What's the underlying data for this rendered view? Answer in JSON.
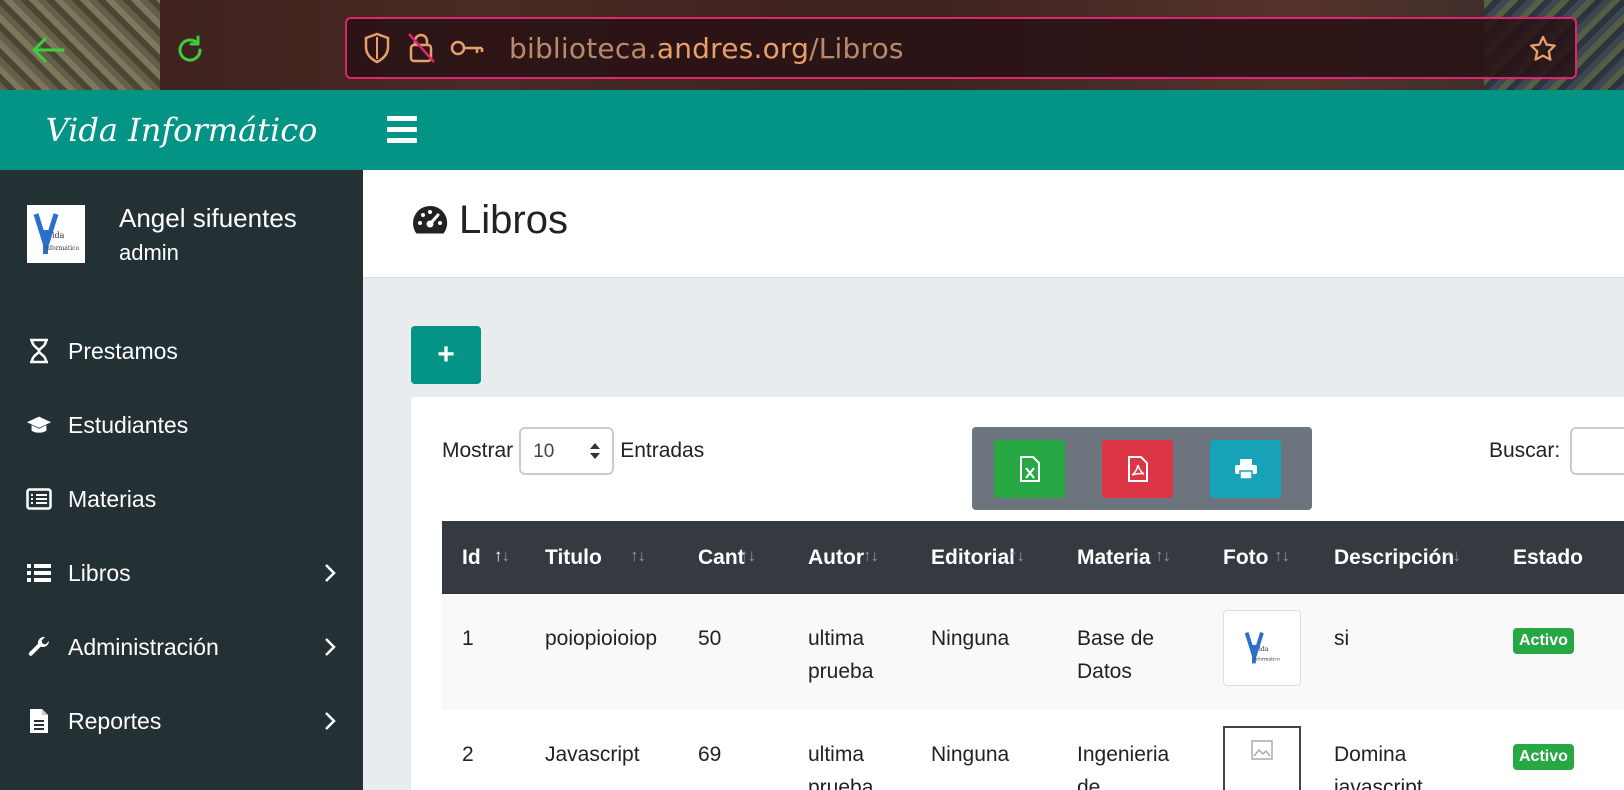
{
  "browser": {
    "url_prefix": "biblioteca.",
    "url_domain": "andres.org",
    "url_path": "/Libros"
  },
  "sidebar": {
    "brand": "Vida Informático",
    "avatar_text": "Vida Informático",
    "user_name": "Angel sifuentes",
    "user_role": "admin",
    "items": [
      {
        "label": "Prestamos",
        "icon": "hourglass-icon",
        "has_children": false
      },
      {
        "label": "Estudiantes",
        "icon": "graduation-cap-icon",
        "has_children": false
      },
      {
        "label": "Materias",
        "icon": "list-alt-icon",
        "has_children": false
      },
      {
        "label": "Libros",
        "icon": "list-icon",
        "has_children": true
      },
      {
        "label": "Administración",
        "icon": "wrench-icon",
        "has_children": true
      },
      {
        "label": "Reportes",
        "icon": "file-icon",
        "has_children": true
      }
    ]
  },
  "page": {
    "title": "Libros",
    "add_label": "+"
  },
  "table_controls": {
    "show_label": "Mostrar",
    "page_size": "10",
    "entries_label": "Entradas",
    "search_label": "Buscar:"
  },
  "table": {
    "columns": [
      "Id",
      "Titulo",
      "Cant",
      "Autor",
      "Editorial",
      "Materia",
      "Foto",
      "Descripción",
      "Estado"
    ],
    "rows": [
      {
        "id": "1",
        "titulo": "poiopioioiop",
        "cant": "50",
        "autor": "ultima prueba",
        "editorial": "Ninguna",
        "materia": "Base de Datos",
        "descripcion": "si",
        "estado": "Activo"
      },
      {
        "id": "2",
        "titulo": "Javascript",
        "cant": "69",
        "autor": "ultima prueba",
        "editorial": "Ninguna",
        "materia": "Ingenieria de",
        "descripcion": "Domina javascript",
        "estado": "Activo"
      }
    ]
  },
  "colors": {
    "teal": "#039485",
    "sidebar": "#233134",
    "excel": "#28a745",
    "pdf": "#dc3545",
    "print": "#17a2b8"
  }
}
